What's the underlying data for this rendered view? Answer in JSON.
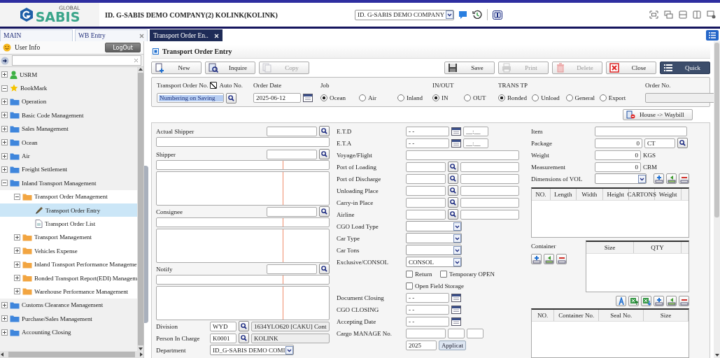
{
  "header": {
    "logo_tagline": "GLOBAL",
    "logo_text": "SABIS",
    "company_info": "ID. G-SABIS DEMO COMPANY(2) KOLINK(KOLINK)",
    "company_select": "ID. G-SABIS DEMO COMPANY"
  },
  "tabs": [
    {
      "label": "MAIN",
      "selected": false,
      "closable": false
    },
    {
      "label": "WB Entry",
      "selected": false,
      "closable": true
    },
    {
      "label": "Transport Order En..",
      "selected": true,
      "closable": true
    }
  ],
  "sidebar": {
    "user_info": "User Info",
    "logout": "LogOut",
    "tree": [
      {
        "label": "USRM",
        "kind": "user",
        "expanded": false,
        "selected": false
      },
      {
        "label": "BookMark",
        "kind": "star",
        "expanded": true,
        "selected": false
      },
      {
        "label": "Operation",
        "kind": "folder",
        "expanded": false,
        "selected": false
      },
      {
        "label": "Basic Code Management",
        "kind": "folder",
        "expanded": false,
        "selected": false
      },
      {
        "label": "Sales Management",
        "kind": "folder",
        "expanded": false,
        "selected": false
      },
      {
        "label": "Ocean",
        "kind": "folder",
        "expanded": false,
        "selected": false
      },
      {
        "label": "Air",
        "kind": "folder",
        "expanded": false,
        "selected": false
      },
      {
        "label": "Freight Settlement",
        "kind": "folder",
        "expanded": false,
        "selected": false
      },
      {
        "label": "Inland Transport Management",
        "kind": "folder",
        "expanded": true,
        "selected": false,
        "children": [
          {
            "label": "Transport Order Management",
            "kind": "folder",
            "expanded": true,
            "selected": false,
            "children": [
              {
                "label": "Transport Order Entry",
                "kind": "edit",
                "selected": true
              },
              {
                "label": "Transport Order List",
                "kind": "page",
                "selected": false
              }
            ]
          },
          {
            "label": "Transport Management",
            "kind": "folder",
            "expanded": false,
            "selected": false
          },
          {
            "label": "Vehicles Expense",
            "kind": "folder",
            "expanded": false,
            "selected": false
          },
          {
            "label": "Inland Transport Performance Manageme",
            "kind": "folder",
            "expanded": false,
            "selected": false
          },
          {
            "label": "Bonded Transport Report(EDI) Managem",
            "kind": "folder",
            "expanded": false,
            "selected": false
          },
          {
            "label": "Warehouse Performance Management",
            "kind": "folder",
            "expanded": false,
            "selected": false
          }
        ]
      },
      {
        "label": "Customs Clearance Management",
        "kind": "folder",
        "expanded": false,
        "selected": false
      },
      {
        "label": "Purchase/Sales Management",
        "kind": "folder",
        "expanded": false,
        "selected": false
      },
      {
        "label": "Accounting Closing",
        "kind": "folder",
        "expanded": false,
        "selected": false
      }
    ]
  },
  "page": {
    "title": "Transport Order Entry",
    "toolbar": {
      "left": [
        {
          "label": "New",
          "disabled": false,
          "primary": false
        },
        {
          "label": "Inquire",
          "disabled": false,
          "primary": false
        },
        {
          "label": "Copy",
          "disabled": true,
          "primary": false
        }
      ],
      "right": [
        {
          "label": "Save",
          "disabled": false,
          "primary": false
        },
        {
          "label": "Print",
          "disabled": true,
          "primary": false
        },
        {
          "label": "Delete",
          "disabled": true,
          "primary": false
        },
        {
          "label": "Close",
          "disabled": false,
          "primary": false
        },
        {
          "label": "Quick",
          "disabled": false,
          "primary": true
        }
      ]
    },
    "criteria": {
      "order_no_label": "Transport Order No.",
      "auto_no": {
        "label": "Auto No.",
        "checked": true
      },
      "order_no_value": "Numbering on Saving",
      "order_date_label": "Order Date",
      "order_date": "2025-06-12",
      "groups": [
        {
          "label": "Job",
          "options": [
            {
              "label": "Ocean",
              "selected": true
            },
            {
              "label": "Air",
              "selected": false
            },
            {
              "label": "Inland",
              "selected": false
            }
          ]
        },
        {
          "label": "IN/OUT",
          "options": [
            {
              "label": "IN",
              "selected": true
            },
            {
              "label": "OUT",
              "selected": false
            }
          ]
        },
        {
          "label": "TRANS TP",
          "options": [
            {
              "label": "Bonded",
              "selected": true
            },
            {
              "label": "Unload",
              "selected": false
            },
            {
              "label": "General",
              "selected": false
            },
            {
              "label": "Export",
              "selected": false
            }
          ]
        }
      ],
      "order_no2_label": "Order No."
    },
    "house_button": "House -> Waybill",
    "parties": [
      {
        "label": "Actual Shipper",
        "kind": "name_only"
      },
      {
        "label": "Shipper",
        "kind": "address"
      },
      {
        "label": "Consignee",
        "kind": "address"
      },
      {
        "label": "Notify",
        "kind": "address"
      }
    ],
    "division": {
      "label": "Division",
      "code": "WYD",
      "name": "1634YLO620 [CAKU] Cont"
    },
    "person": {
      "label": "Person In Charge",
      "code": "K0001",
      "name": "KOLINK"
    },
    "department": {
      "label": "Department",
      "value": "ID_G-SABIS DEMO COMI"
    },
    "details": [
      {
        "kind": "datetime",
        "label": "E.T.D",
        "value": "- -",
        "time": "__:__"
      },
      {
        "kind": "datetime",
        "label": "E.T.A",
        "value": "- -",
        "time": "__:__"
      },
      {
        "kind": "text",
        "label": "Voyage/Flight"
      },
      {
        "kind": "lookup",
        "label": "Port of Loading"
      },
      {
        "kind": "lookup",
        "label": "Port of Discharge"
      },
      {
        "kind": "lookup",
        "label": "Unloading Place"
      },
      {
        "kind": "lookup",
        "label": "Carry-in Place"
      },
      {
        "kind": "lookup",
        "label": "Airline"
      },
      {
        "kind": "select",
        "label": "CGO Load Type"
      },
      {
        "kind": "select",
        "label": "Car Type"
      },
      {
        "kind": "select",
        "label": "Car Tons"
      },
      {
        "kind": "select",
        "label": "Exclusive/CONSOL",
        "value": "CONSOL"
      },
      {
        "kind": "checks",
        "items": [
          {
            "label": "Return",
            "checked": false
          },
          {
            "label": "Temporary OPEN",
            "checked": false
          }
        ]
      },
      {
        "kind": "checks",
        "items": [
          {
            "label": "Open Field Storage",
            "checked": false
          }
        ]
      },
      {
        "kind": "date",
        "label": "Document Closing",
        "value": "- -"
      },
      {
        "kind": "date",
        "label": "CGO CLOSING",
        "value": "- -"
      },
      {
        "kind": "date",
        "label": "Accepting Date",
        "value": "- -"
      },
      {
        "kind": "triple",
        "label": "Cargo MANAGE No."
      },
      {
        "kind": "year",
        "value": "2025",
        "button": "Applicat"
      }
    ],
    "item_label": "Item",
    "measures": [
      {
        "label": "Package",
        "value": "0",
        "unit": "CT",
        "kind": "lookup"
      },
      {
        "label": "Weight",
        "value": "0",
        "unit": "KGS",
        "kind": "plain"
      },
      {
        "label": "Measurement",
        "value": "0",
        "unit": "CBM",
        "kind": "plain"
      }
    ],
    "dims_label": "Dimensions of VOL",
    "dims_columns": [
      "NO.",
      "Length",
      "Width",
      "Height",
      "CARTONS",
      "Weight"
    ],
    "container_label": "Container",
    "container_columns": [
      "Size",
      "QTY"
    ],
    "detail_columns": [
      "NO.",
      "Container No.",
      "Seal No.",
      "Size"
    ]
  }
}
